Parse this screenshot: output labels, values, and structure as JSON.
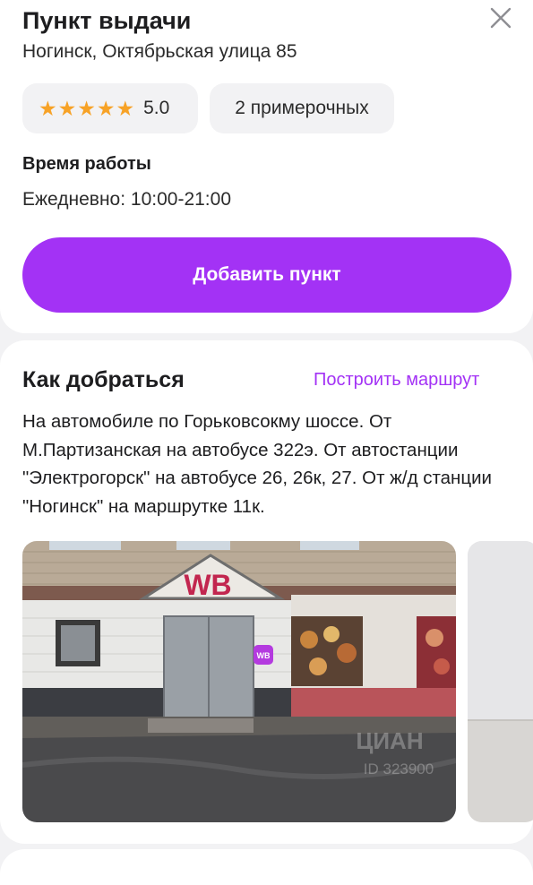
{
  "point": {
    "title": "Пункт выдачи",
    "address": "Ногинск, Октябрьская улица 85",
    "rating": "5.0",
    "rating_stars": 5,
    "fitting_rooms": "2 примерочных",
    "hours_title": "Время работы",
    "hours_text": "Ежедневно: 10:00-21:00",
    "add_button": "Добавить пункт"
  },
  "route": {
    "title": "Как добраться",
    "build_route": "Построить маршрут",
    "description": "На автомобиле по Горьковсокму шоссе. От М.Партизанская на автобусе 322э. От автостанции \"Электрогорск\" на автобусе 26, 26к, 27. От ж/д станции \"Ногинск\" на маршрутке 11к."
  },
  "photo": {
    "sign_text": "WB",
    "badge_text": "WB",
    "watermark": "ЦИАН",
    "watermark_id": "ID 323900"
  },
  "colors": {
    "accent": "#a332f5",
    "star": "#f7a226",
    "chip_bg": "#f2f2f4"
  },
  "icons": [
    "close-icon",
    "star-icon"
  ]
}
